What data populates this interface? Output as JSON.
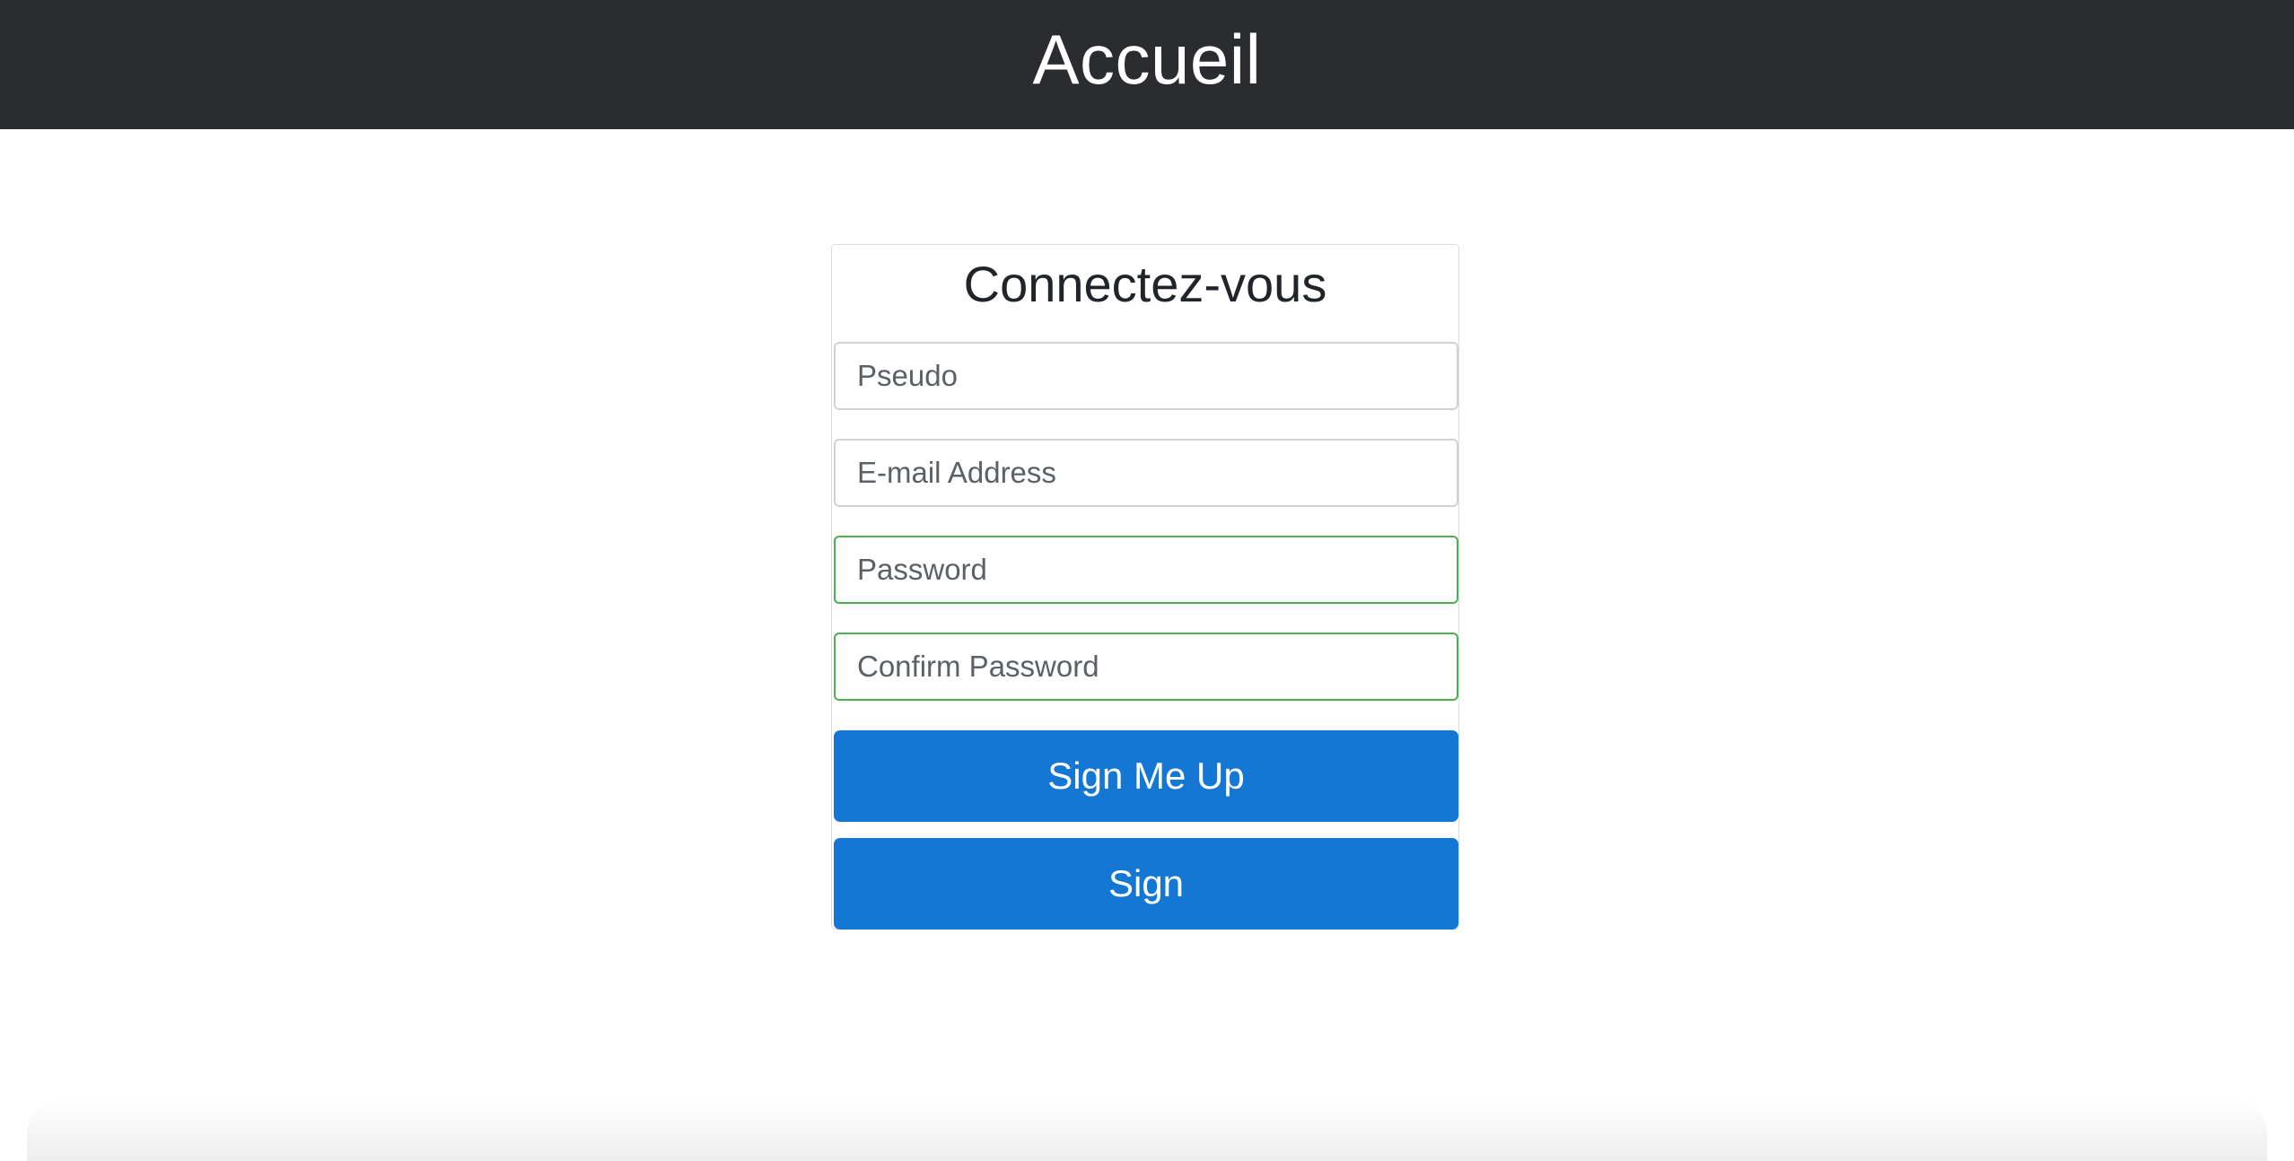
{
  "header": {
    "title": "Accueil"
  },
  "form": {
    "title": "Connectez-vous",
    "pseudo_placeholder": "Pseudo",
    "email_placeholder": "E-mail Address",
    "password_placeholder": "Password",
    "confirm_password_placeholder": "Confirm Password",
    "signup_label": "Sign Me Up",
    "sign_label": "Sign"
  },
  "colors": {
    "header_background": "#2b2c2f",
    "button_primary": "#1577d4",
    "valid_border": "#4caf50"
  }
}
